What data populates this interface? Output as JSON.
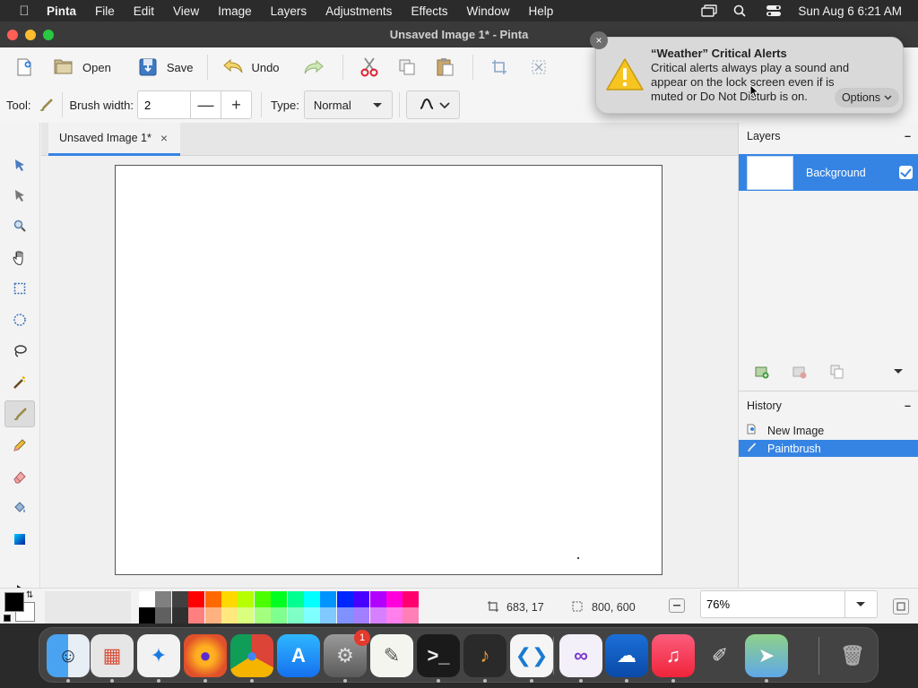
{
  "menubar": {
    "app": "Pinta",
    "items": [
      "File",
      "Edit",
      "View",
      "Image",
      "Layers",
      "Adjustments",
      "Effects",
      "Window",
      "Help"
    ],
    "clock": "Sun Aug 6  6:21 AM"
  },
  "window": {
    "title": "Unsaved Image 1* - Pinta"
  },
  "toolbar": {
    "open_label": "Open",
    "save_label": "Save",
    "undo_label": "Undo"
  },
  "options": {
    "tool_label": "Tool:",
    "brush_width_label": "Brush width:",
    "brush_width_value": "2",
    "type_label": "Type:",
    "type_value": "Normal"
  },
  "document": {
    "tab_title": "Unsaved Image 1*"
  },
  "layers": {
    "header": "Layers",
    "items": [
      {
        "name": "Background",
        "visible": true
      }
    ]
  },
  "history": {
    "header": "History",
    "items": [
      {
        "label": "New Image",
        "selected": false
      },
      {
        "label": "Paintbrush",
        "selected": true
      }
    ]
  },
  "status": {
    "cursor_position": "683, 17",
    "image_size": "800, 600",
    "zoom": "76%"
  },
  "palette": {
    "top": [
      "#ffffff",
      "#808080",
      "#404040",
      "#ff0000",
      "#ff6a00",
      "#ffd800",
      "#b6ff00",
      "#4cff00",
      "#00ff21",
      "#00ff90",
      "#00ffff",
      "#0094ff",
      "#0026ff",
      "#4800ff",
      "#b200ff",
      "#ff00dc",
      "#ff006e"
    ],
    "bottom": [
      "#000000",
      "#606060",
      "#303030",
      "#ff7f7f",
      "#ffb27f",
      "#ffe97f",
      "#daff7f",
      "#a5ff7f",
      "#7fff8e",
      "#7fffc5",
      "#7fffff",
      "#7fc9ff",
      "#7f92ff",
      "#a17fff",
      "#d67fff",
      "#ff7fed",
      "#ff7fb6"
    ],
    "primary": "#000000",
    "secondary": "#ffffff"
  },
  "notification": {
    "title": "“Weather” Critical Alerts",
    "body": "Critical alerts always play a sound and appear on the lock screen even if  is muted or Do Not Disturb is on.",
    "options_label": "Options"
  },
  "dock": {
    "apps": [
      "finder-icon",
      "launchpad-icon",
      "safari-icon",
      "firefox-icon",
      "chrome-icon",
      "app-store-icon",
      "system-settings-icon",
      "textedit-icon",
      "terminal-icon",
      "garageband-icon",
      "vscode-icon",
      "visual-studio-icon",
      "onedrive-icon",
      "music-icon",
      "pinta-icon",
      "maps-icon",
      "trash-icon"
    ],
    "settings_badge": "1"
  },
  "colors": {
    "accent": "#3584e4",
    "titlebar": "#3a3a3a",
    "menubar": "#2b2b2b"
  }
}
